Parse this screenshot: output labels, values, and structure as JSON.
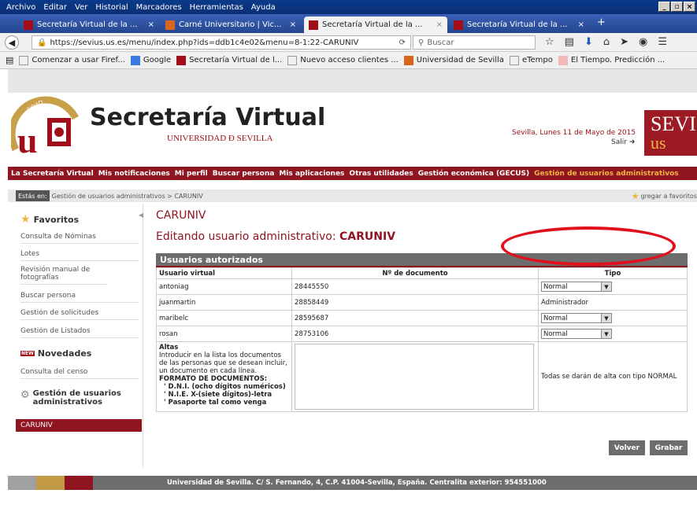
{
  "browser": {
    "menu": [
      "Archivo",
      "Editar",
      "Ver",
      "Historial",
      "Marcadores",
      "Herramientas",
      "Ayuda"
    ],
    "win_buttons": [
      "_",
      "▫",
      "×"
    ],
    "tabs": [
      {
        "label": "Secretaría Virtual de la ...",
        "close": "×",
        "active": false
      },
      {
        "label": "Carné Universitario | Vic...",
        "close": "×",
        "active": false
      },
      {
        "label": "Secretaría Virtual de la ...",
        "close": "×",
        "active": true
      },
      {
        "label": "Secretaría Virtual de la ...",
        "close": "×",
        "active": false
      }
    ],
    "new_tab": "+",
    "url": "https://sevius.us.es/menu/index.php?ids=ddb1c4e02&menu=8-1:22-CARUNIV",
    "search_placeholder": "Buscar",
    "bookmarks": [
      "Comenzar a usar Firef...",
      "Google",
      "Secretaría Virtual de l...",
      "Nuevo acceso clientes ...",
      "Universidad de Sevilla",
      "eTempo",
      "El Tiempo. Predicción ..."
    ]
  },
  "site": {
    "title": "Secretaría Virtual",
    "subtitle": "UNIVERSIDAD Ð SEVILLA",
    "date": "Sevilla, Lunes 11 de Mayo de 2015",
    "salir": "Salir",
    "badge_top": "SEVI",
    "badge_bottom": "us",
    "nav": [
      "La Secretaría Virtual",
      "Mis notificaciones",
      "Mi perfil",
      "Buscar persona",
      "Mis aplicaciones",
      "Otras utilidades",
      "Gestión económica (GECUS)",
      "Gestión de usuarios administrativos"
    ],
    "crumb_label": "Estás en:",
    "crumb_path": "Gestión de usuarios administrativos > CARUNIV",
    "add_fav": "gregar a favoritos"
  },
  "sidebar": {
    "favoritos": "Favoritos",
    "fav_items": [
      "Consulta de Nóminas",
      "Lotes",
      "Revisión manual de fotografías",
      "Buscar persona",
      "Gestión de solicitudes",
      "Gestión de Listados"
    ],
    "novedades": "Novedades",
    "nov_items": [
      "Consulta del censo"
    ],
    "gestion": "Gestión de usuarios administrativos",
    "active": "CARUNIV"
  },
  "main": {
    "title": "CARUNIV",
    "subtitle_prefix": "Editando usuario administrativo: ",
    "subtitle_user": "CARUNIV",
    "table_title": "Usuarios autorizados",
    "columns": [
      "Usuario virtual",
      "Nº de documento",
      "Tipo"
    ],
    "rows": [
      {
        "user": "antoniag",
        "doc": "28445550",
        "tipo": "Normal",
        "select": true
      },
      {
        "user": "juanmartin",
        "doc": "28858449",
        "tipo": "Administrador",
        "select": false
      },
      {
        "user": "maribelc",
        "doc": "28595687",
        "tipo": "Normal",
        "select": true
      },
      {
        "user": "rosan",
        "doc": "28753106",
        "tipo": "Normal",
        "select": true
      }
    ],
    "altas_title": "Altas",
    "altas_desc": "Introducir en la lista los documentos de las personas que se desean incluir, un documento en cada línea.",
    "formato_title": "FORMATO DE DOCUMENTOS:",
    "formato_items": [
      "' D.N.I. (ocho dígitos numéricos)",
      "' N.I.E. X-(siete dígitos)-letra",
      "' Pasaporte tal como venga"
    ],
    "altas_note": "Todas se darán de alta con tipo NORMAL",
    "btn_volver": "Volver",
    "btn_grabar": "Grabar"
  },
  "footer": "Universidad de Sevilla. C/ S. Fernando, 4, C.P. 41004-Sevilla, España. Centralita exterior: 954551000"
}
